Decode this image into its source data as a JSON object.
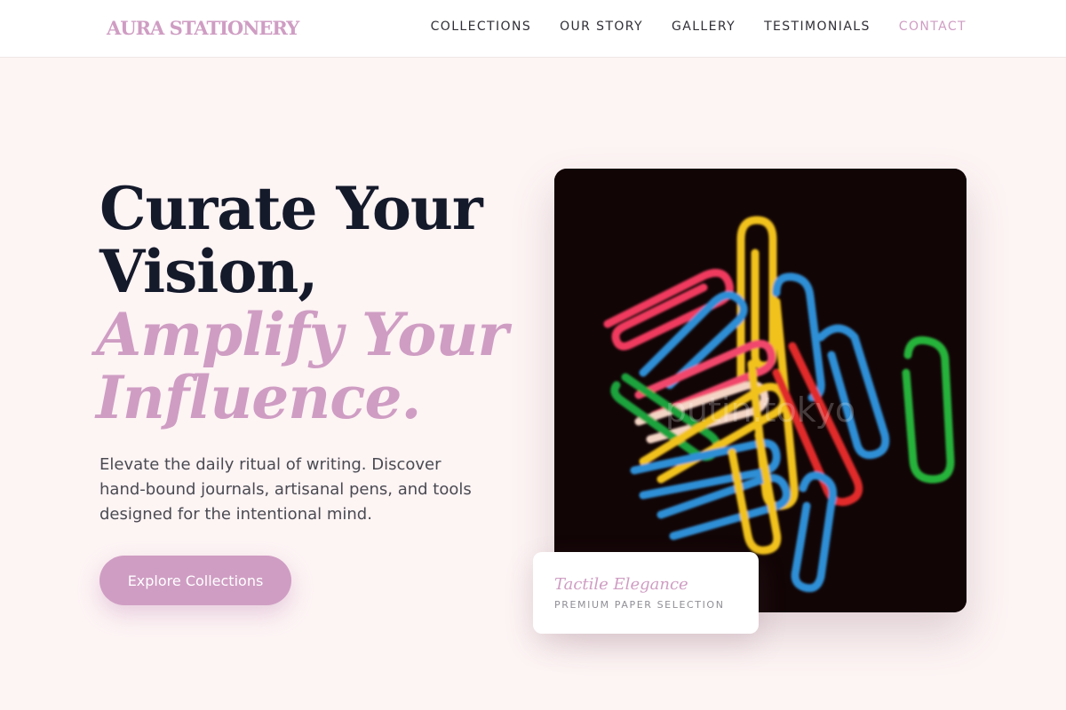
{
  "brand": {
    "name": "AURA STATIONERY"
  },
  "nav": {
    "items": [
      {
        "label": "COLLECTIONS"
      },
      {
        "label": "OUR STORY"
      },
      {
        "label": "GALLERY"
      },
      {
        "label": "TESTIMONIALS"
      },
      {
        "label": "CONTACT"
      }
    ],
    "active": "CONTACT"
  },
  "hero": {
    "title_line1": "Curate Your",
    "title_line2": "Vision,",
    "accent_line1": "Amplify Your",
    "accent_line2": "Influence.",
    "description": "Elevate the daily ritual of writing. Discover hand-bound journals, artisanal pens, and tools designed for the intentional mind.",
    "cta_label": "Explore Collections"
  },
  "feature": {
    "image_subject": "colorful paper clips on dark background",
    "watermark": "putin.tokyo",
    "caption_title": "Tactile Elegance",
    "caption_subtitle": "PREMIUM PAPER SELECTION"
  },
  "colors": {
    "accent": "#cf9dc3",
    "background": "#fdf4f4",
    "heading": "#151a2b",
    "body_text": "#4a4a52"
  }
}
